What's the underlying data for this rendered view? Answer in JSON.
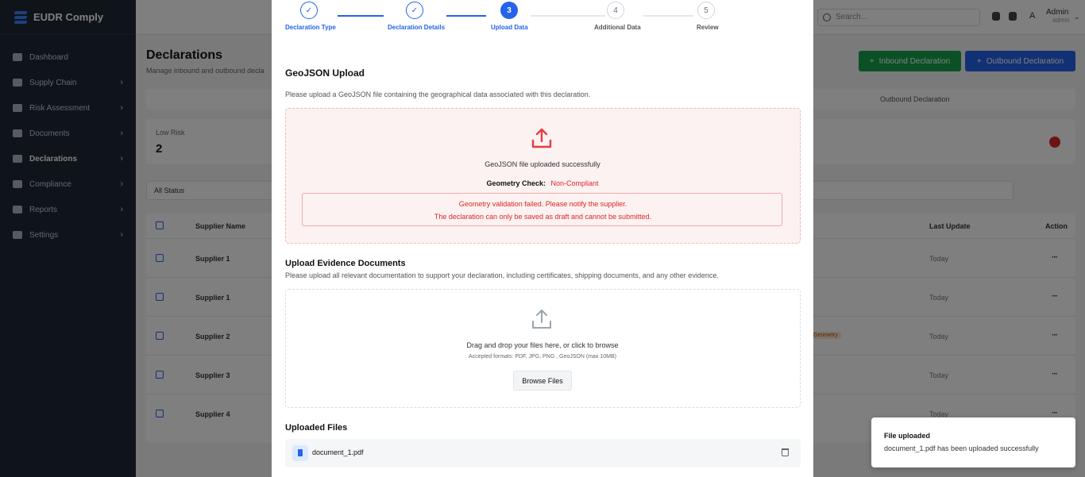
{
  "app": {
    "brand": "EUDR Comply",
    "sidebar": [
      {
        "label": "Dashboard",
        "icon": "home-icon",
        "chevron": false
      },
      {
        "label": "Supply Chain",
        "icon": "network-icon",
        "chevron": true
      },
      {
        "label": "Risk Assessment",
        "icon": "warning-icon",
        "chevron": true
      },
      {
        "label": "Documents",
        "icon": "file-icon",
        "chevron": true
      },
      {
        "label": "Declarations",
        "icon": "clipboard-icon",
        "chevron": true,
        "active": true
      },
      {
        "label": "Compliance",
        "icon": "check-circle-icon",
        "chevron": true
      },
      {
        "label": "Reports",
        "icon": "chart-icon",
        "chevron": true
      },
      {
        "label": "Settings",
        "icon": "gear-icon",
        "chevron": true
      }
    ],
    "topbar": {
      "search_placeholder": "Search...",
      "avatar_initial": "A",
      "user_name": "Admin",
      "user_role": "admin"
    },
    "page": {
      "title": "Declarations",
      "subtitle": "Manage inbound and outbound decla",
      "inbound_button": "Inbound Declaration",
      "outbound_button": "Outbound Declaration",
      "outbound_tab": "Outbound Declaration",
      "stat_label": "Low Risk",
      "stat_value": "2",
      "filter_status": "All Status",
      "columns": {
        "supplier": "Supplier Name",
        "last_update": "Last Update",
        "action": "Action"
      },
      "rows": [
        {
          "supplier": "Supplier 1",
          "last_update": "Today"
        },
        {
          "supplier": "Supplier 1",
          "last_update": "Today"
        },
        {
          "supplier": "Supplier 2",
          "last_update": "Today",
          "badge": "Geometry"
        },
        {
          "supplier": "Supplier 3",
          "last_update": "Today"
        },
        {
          "supplier": "Supplier 4",
          "last_update": "Today"
        }
      ]
    }
  },
  "modal": {
    "steps": [
      {
        "number": "✓",
        "label": "Declaration Type",
        "state": "done"
      },
      {
        "number": "✓",
        "label": "Declaration Details",
        "state": "done"
      },
      {
        "number": "3",
        "label": "Upload Data",
        "state": "current"
      },
      {
        "number": "4",
        "label": "Additional Data",
        "state": "todo"
      },
      {
        "number": "5",
        "label": "Review",
        "state": "todo"
      }
    ],
    "geojson": {
      "title": "GeoJSON Upload",
      "description": "Please upload a GeoJSON file containing the geographical data associated with this declaration.",
      "success_text": "GeoJSON file uploaded successfully",
      "geometry_check_label": "Geometry Check:",
      "geometry_check_value": "Non-Compliant",
      "alert_line1": "Geometry validation failed. Please notify the supplier.",
      "alert_line2": "The declaration can only be saved as draft and cannot be submitted."
    },
    "evidence": {
      "title": "Upload Evidence Documents",
      "description": "Please upload all relevant documentation to support your declaration, including certificates, shipping documents, and any other evidence.",
      "drop_text": "Drag and drop your files here, or click to browse",
      "formats": "Accepted formats: PDF, JPG, PNG , GeoJSON (max 10MB)",
      "browse_button": "Browse Files"
    },
    "uploaded": {
      "title": "Uploaded Files",
      "files": [
        {
          "name": "document_1.pdf"
        }
      ]
    }
  },
  "toast": {
    "title": "File uploaded",
    "message": "document_1.pdf has been uploaded successfully"
  },
  "colors": {
    "primary": "#2563eb",
    "success": "#16a34a",
    "danger": "#dc2626",
    "sidebar": "#1f2937"
  }
}
